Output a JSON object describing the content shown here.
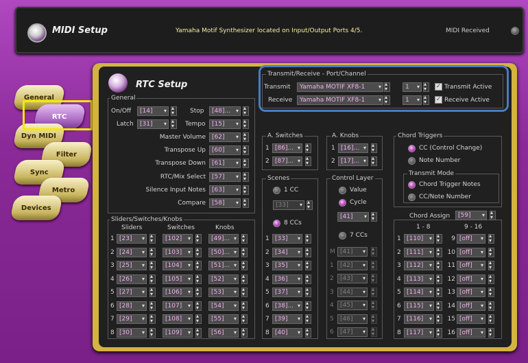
{
  "header": {
    "title": "MIDI Setup",
    "message": "Yamaha Motif Synthesizer located on Input/Output Ports 4/5.",
    "midi_received": "MIDI Received"
  },
  "tabs": [
    "General",
    "RTC",
    "Dyn MIDI",
    "Filter",
    "Sync",
    "Metro",
    "Devices"
  ],
  "rtc_title": "RTC Setup",
  "transmit_receive": {
    "label": "Transmit/Receive - Port/Channel",
    "transmit_label": "Transmit",
    "transmit_port": "Yamaha MOTIF XF8-1",
    "transmit_channel": "1",
    "transmit_active": "Transmit Active",
    "receive_label": "Receive",
    "receive_port": "Yamaha MOTIF XF8-1",
    "receive_channel": "1",
    "receive_active": "Receive Active"
  },
  "general": {
    "label": "General",
    "onoff_label": "On/Off",
    "onoff": "[14]",
    "latch_label": "Latch",
    "latch": "[31]",
    "stop_label": "Stop",
    "stop": "[48]...",
    "tempo_label": "Tempo",
    "tempo": "[15]",
    "rows": [
      {
        "label": "Master Volume",
        "value": "[62]"
      },
      {
        "label": "Transpose Up",
        "value": "[60]"
      },
      {
        "label": "Transpose Down",
        "value": "[61]"
      },
      {
        "label": "RTC/Mix Select",
        "value": "[57]"
      },
      {
        "label": "Silence Input Notes",
        "value": "[63]"
      },
      {
        "label": "Compare",
        "value": "[58]"
      }
    ]
  },
  "ssk": {
    "label": "Sliders/Switches/Knobs",
    "col_sliders": "Sliders",
    "col_switches": "Switches",
    "col_knobs": "Knobs",
    "rows": [
      [
        "1",
        "[23]",
        "[102]",
        "[49]..."
      ],
      [
        "2",
        "[24]",
        "[103]",
        "[50]..."
      ],
      [
        "3",
        "[25]",
        "[104]",
        "[51]..."
      ],
      [
        "4",
        "[26]",
        "[105]",
        "[52]"
      ],
      [
        "5",
        "[27]",
        "[106]",
        "[53]"
      ],
      [
        "6",
        "[28]",
        "[107]",
        "[54]"
      ],
      [
        "7",
        "[29]",
        "[108]",
        "[55]"
      ],
      [
        "8",
        "[30]",
        "[109]",
        "[56]"
      ]
    ]
  },
  "a_switches": {
    "label": "A. Switches",
    "rows": [
      [
        "1",
        "[86]..."
      ],
      [
        "2",
        "[87]..."
      ]
    ]
  },
  "a_knobs": {
    "label": "A. Knobs",
    "rows": [
      [
        "1",
        "[16]..."
      ],
      [
        "2",
        "[17]..."
      ]
    ]
  },
  "scenes": {
    "label": "Scenes",
    "one_cc": "1 CC",
    "one_cc_value": "[33]",
    "eight_ccs": "8 CCs",
    "rows": [
      [
        "1",
        "[33]"
      ],
      [
        "2",
        "[34]"
      ],
      [
        "3",
        "[35]"
      ],
      [
        "4",
        "[36]"
      ],
      [
        "5",
        "[37]"
      ],
      [
        "6",
        "[38]..."
      ],
      [
        "7",
        "[39]"
      ],
      [
        "8",
        "[40]"
      ]
    ]
  },
  "control_layer": {
    "label": "Control Layer",
    "value_opt": "Value",
    "cycle_opt": "Cycle",
    "cycle_value": "[41]",
    "seven_ccs": "7 CCs",
    "rows": [
      [
        "M",
        "[41]"
      ],
      [
        "1",
        "[42]"
      ],
      [
        "2",
        "[43]"
      ],
      [
        "3",
        "[44]"
      ],
      [
        "4",
        "[45]"
      ],
      [
        "5",
        "[46]"
      ],
      [
        "6",
        "[47]"
      ]
    ]
  },
  "chord_triggers": {
    "label": "Chord Triggers",
    "cc_opt": "CC (Control Change)",
    "note_opt": "Note Number",
    "transmit_mode": "Transmit Mode",
    "ctn_opt": "Chord Trigger Notes",
    "ccn_opt": "CC/Note Number",
    "assign_label": "Chord Assign",
    "assign_value": "[59]",
    "col1": "1 - 8",
    "col2": "9 - 16",
    "left": [
      [
        "1",
        "[110]"
      ],
      [
        "2",
        "[111]"
      ],
      [
        "3",
        "[112]"
      ],
      [
        "4",
        "[113]"
      ],
      [
        "5",
        "[114]"
      ],
      [
        "6",
        "[115]"
      ],
      [
        "7",
        "[116]"
      ],
      [
        "8",
        "[117]"
      ]
    ],
    "right": [
      [
        "9",
        "[off]"
      ],
      [
        "10",
        "[off]"
      ],
      [
        "11",
        "[off]"
      ],
      [
        "12",
        "[off]"
      ],
      [
        "13",
        "[off]"
      ],
      [
        "14",
        "[off]"
      ],
      [
        "15",
        "[off]"
      ],
      [
        "16",
        "[off]"
      ]
    ]
  }
}
